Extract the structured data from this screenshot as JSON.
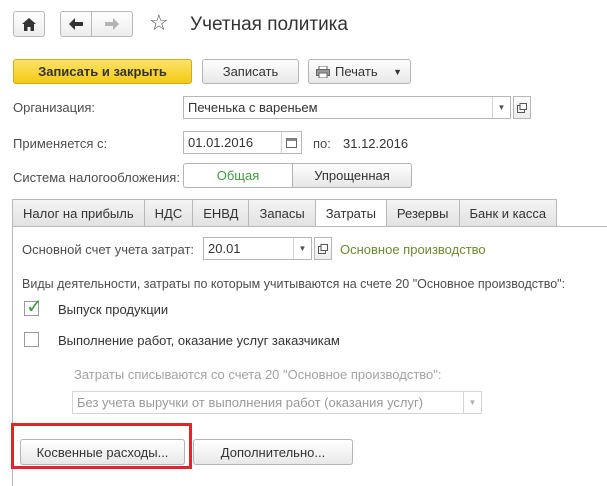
{
  "header": {
    "title": "Учетная политика"
  },
  "toolbar": {
    "save_close": "Записать и закрыть",
    "save": "Записать",
    "print": "Печать"
  },
  "form": {
    "org_label": "Организация:",
    "org_value": "Печенька с вареньем",
    "applies_label": "Применяется с:",
    "date_from": "01.01.2016",
    "to_label": "по:",
    "date_to": "31.12.2016",
    "tax_label": "Система налогообложения:",
    "tax_general": "Общая",
    "tax_simplified": "Упрощенная"
  },
  "tabs": [
    {
      "label": "Налог на прибыль"
    },
    {
      "label": "НДС"
    },
    {
      "label": "ЕНВД"
    },
    {
      "label": "Запасы"
    },
    {
      "label": "Затраты"
    },
    {
      "label": "Резервы"
    },
    {
      "label": "Банк и касса"
    }
  ],
  "costs": {
    "account_label": "Основной счет учета затрат:",
    "account_value": "20.01",
    "account_link": "Основное производство",
    "activities_heading": "Виды деятельности, затраты по которым учитываются на счете 20 \"Основное производство\":",
    "cb_production": "Выпуск продукции",
    "cb_production_checked": true,
    "cb_services": "Выполнение работ, оказание услуг заказчикам",
    "cb_services_checked": false,
    "writeoff_label": "Затраты списываются со счета 20 \"Основное производство\":",
    "writeoff_value": "Без учета выручки от выполнения работ (оказания услуг)",
    "indirect_button": "Косвенные расходы...",
    "additional_button": "Дополнительно..."
  },
  "colors": {
    "primary_button": "#f5c912",
    "link": "#6d8a2f",
    "highlight": "#e1252a",
    "tax_general_active": "#3e9c3e"
  }
}
